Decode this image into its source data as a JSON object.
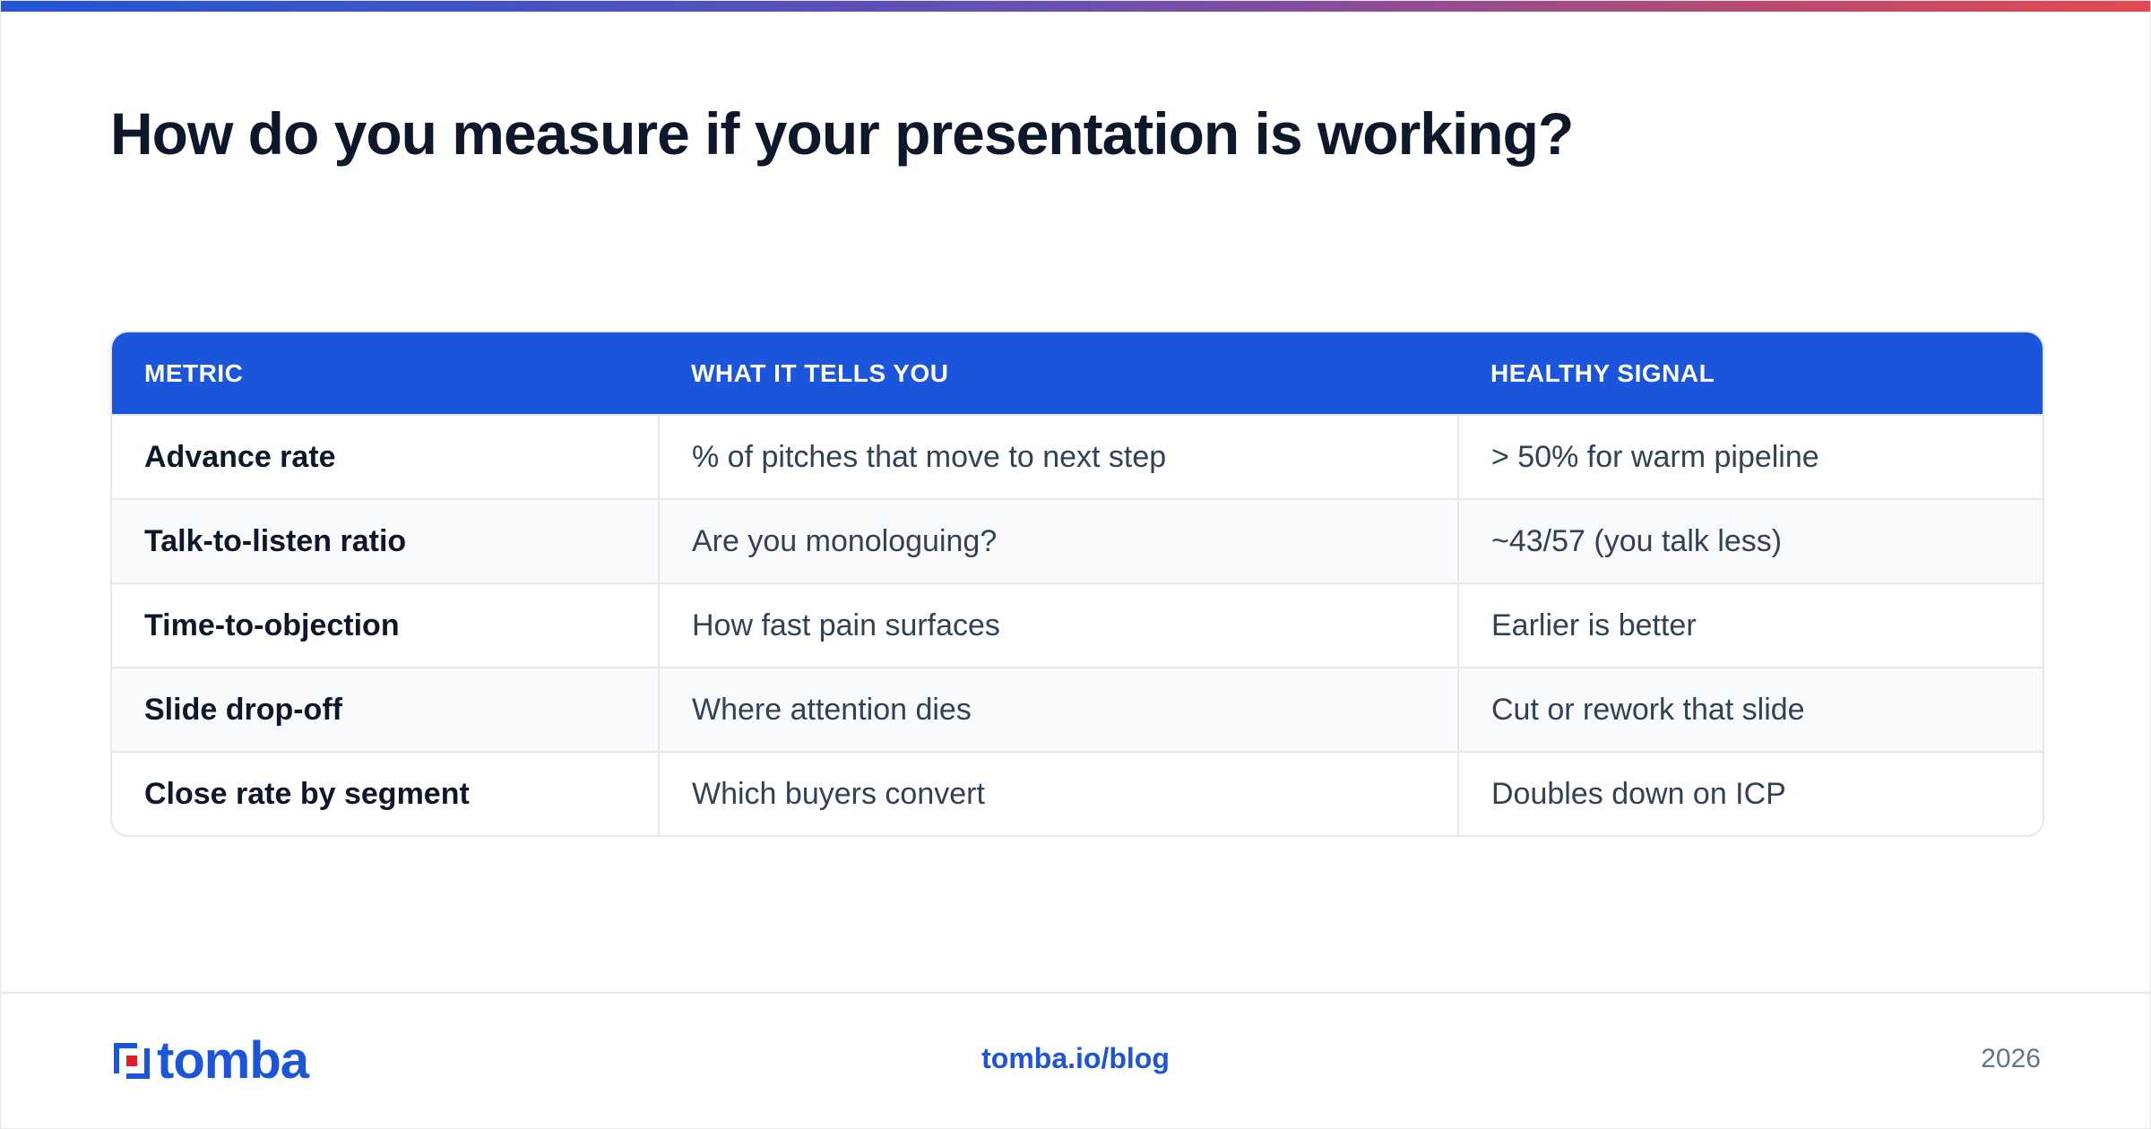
{
  "header": {
    "title": "How do you measure if your presentation is working?"
  },
  "table": {
    "columns": [
      "METRIC",
      "WHAT IT TELLS YOU",
      "HEALTHY SIGNAL"
    ],
    "rows": [
      [
        "Advance rate",
        "% of pitches that move to next step",
        "> 50% for warm pipeline"
      ],
      [
        "Talk-to-listen ratio",
        "Are you monologuing?",
        "~43/57 (you talk less)"
      ],
      [
        "Time-to-objection",
        "How fast pain surfaces",
        "Earlier is better"
      ],
      [
        "Slide drop-off",
        "Where attention dies",
        "Cut or rework that slide"
      ],
      [
        "Close rate by segment",
        "Which buyers convert",
        "Doubles down on ICP"
      ]
    ]
  },
  "footer": {
    "logo_text": "tomba",
    "logo_icon": "tomba-logo-icon",
    "link": "tomba.io/blog",
    "year": "2026"
  },
  "colors": {
    "accent": "#1a55db",
    "logo_red": "#e11d2a",
    "gradient_start": "#2156d9",
    "gradient_end": "#e5484d"
  }
}
